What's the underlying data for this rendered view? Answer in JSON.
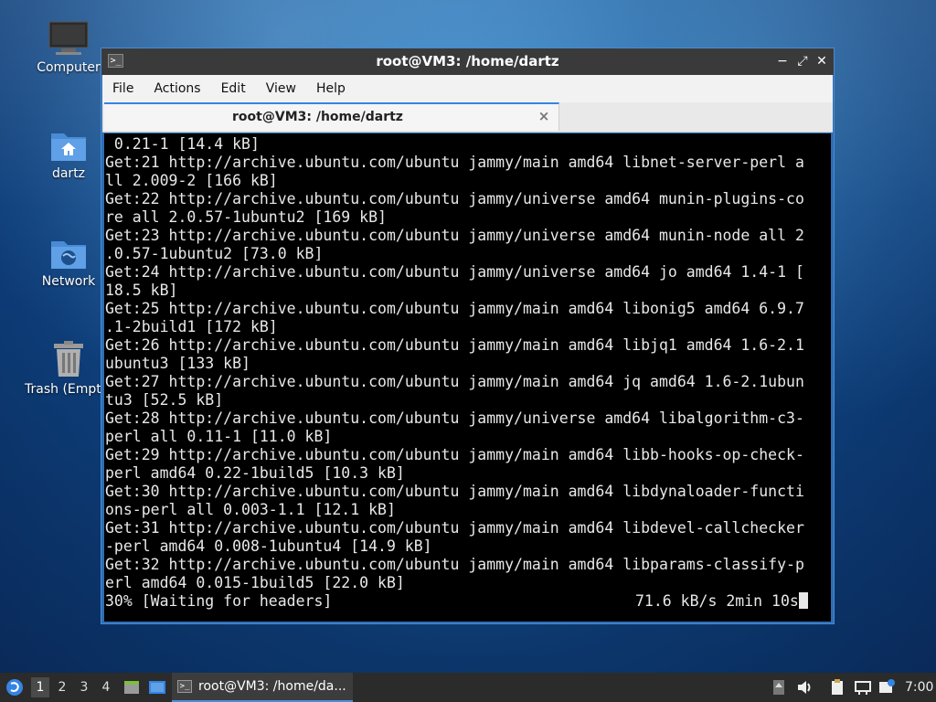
{
  "desktop": {
    "icons": [
      {
        "label": "Computer"
      },
      {
        "label": "dartz"
      },
      {
        "label": "Network"
      },
      {
        "label": "Trash (Empty)"
      }
    ]
  },
  "window": {
    "title": "root@VM3: /home/dartz",
    "menu": [
      "File",
      "Actions",
      "Edit",
      "View",
      "Help"
    ],
    "tab_label": "root@VM3: /home/dartz",
    "tab_close": "×",
    "buttons": {
      "minimize": "−",
      "maximize": "⤢",
      "close": "✕"
    }
  },
  "terminal": {
    "lines": [
      " 0.21-1 [14.4 kB]",
      "Get:21 http://archive.ubuntu.com/ubuntu jammy/main amd64 libnet-server-perl a",
      "ll 2.009-2 [166 kB]",
      "Get:22 http://archive.ubuntu.com/ubuntu jammy/universe amd64 munin-plugins-co",
      "re all 2.0.57-1ubuntu2 [169 kB]",
      "Get:23 http://archive.ubuntu.com/ubuntu jammy/universe amd64 munin-node all 2",
      ".0.57-1ubuntu2 [73.0 kB]",
      "Get:24 http://archive.ubuntu.com/ubuntu jammy/universe amd64 jo amd64 1.4-1 [",
      "18.5 kB]",
      "Get:25 http://archive.ubuntu.com/ubuntu jammy/main amd64 libonig5 amd64 6.9.7",
      ".1-2build1 [172 kB]",
      "Get:26 http://archive.ubuntu.com/ubuntu jammy/main amd64 libjq1 amd64 1.6-2.1",
      "ubuntu3 [133 kB]",
      "Get:27 http://archive.ubuntu.com/ubuntu jammy/main amd64 jq amd64 1.6-2.1ubun",
      "tu3 [52.5 kB]",
      "Get:28 http://archive.ubuntu.com/ubuntu jammy/universe amd64 libalgorithm-c3-",
      "perl all 0.11-1 [11.0 kB]",
      "Get:29 http://archive.ubuntu.com/ubuntu jammy/main amd64 libb-hooks-op-check-",
      "perl amd64 0.22-1build5 [10.3 kB]",
      "Get:30 http://archive.ubuntu.com/ubuntu jammy/main amd64 libdynaloader-functi",
      "ons-perl all 0.003-1.1 [12.1 kB]",
      "Get:31 http://archive.ubuntu.com/ubuntu jammy/main amd64 libdevel-callchecker",
      "-perl amd64 0.008-1ubuntu4 [14.9 kB]",
      "Get:32 http://archive.ubuntu.com/ubuntu jammy/main amd64 libparams-classify-p",
      "erl amd64 0.015-1build5 [22.0 kB]"
    ],
    "status_left": "30% [Waiting for headers]",
    "status_right": "71.6 kB/s 2min 10s"
  },
  "taskbar": {
    "workspaces": [
      "1",
      "2",
      "3",
      "4"
    ],
    "task_label": "root@VM3: /home/da...",
    "clock": "7:00"
  }
}
